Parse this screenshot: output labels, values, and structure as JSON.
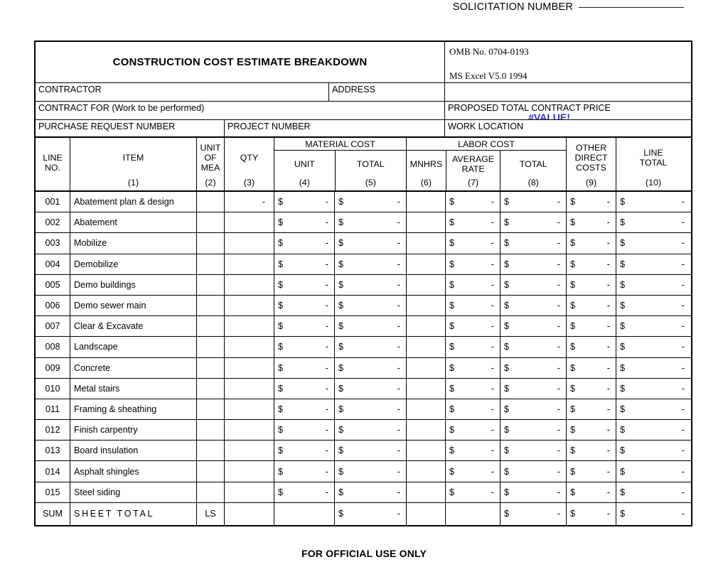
{
  "solicitation": {
    "label": "SOLICITATION NUMBER",
    "blank_line": ""
  },
  "header": {
    "title": "CONSTRUCTION COST ESTIMATE BREAKDOWN",
    "omb_number": "OMB No. 0704-0193",
    "software_version": "MS Excel V5.0 1994",
    "contractor_label": "CONTRACTOR",
    "contractor_value": "",
    "address_label": "ADDRESS",
    "address_value": "",
    "contract_for_label": "CONTRACT FOR (Work to be performed)",
    "contract_for_value": "",
    "proposed_total_label": "PROPOSED TOTAL CONTRACT PRICE",
    "proposed_total_value": "#VALUE!",
    "proposed_total_color": "#3333cc",
    "purchase_request_label": "PURCHASE REQUEST NUMBER",
    "purchase_request_value": "",
    "project_number_label": "PROJECT NUMBER",
    "project_number_value": "",
    "work_location_label": "WORK LOCATION",
    "work_location_value": ""
  },
  "columns": {
    "line_no": {
      "l1": "LINE",
      "l2": "NO.",
      "num": ""
    },
    "item": {
      "l1": "ITEM",
      "l2": "",
      "num": "(1)"
    },
    "unit_of_mea": {
      "l1": "UNIT",
      "l2": "OF",
      "l3": "MEA",
      "num": "(2)"
    },
    "qty": {
      "l1": "QTY",
      "l2": "",
      "num": "(3)"
    },
    "material_group": "MATERIAL COST",
    "material_unit": {
      "l1": "UNIT",
      "l2": "",
      "num": "(4)"
    },
    "material_total": {
      "l1": "TOTAL",
      "l2": "",
      "num": "(5)"
    },
    "labor_group": "LABOR COST",
    "mnhrs": {
      "l1": "MNHRS",
      "l2": "",
      "num": "(6)"
    },
    "average_rate": {
      "l1": "AVERAGE",
      "l2": "RATE",
      "num": "(7)"
    },
    "labor_total": {
      "l1": "TOTAL",
      "l2": "",
      "num": "(8)"
    },
    "other_direct": {
      "l1": "OTHER",
      "l2": "DIRECT",
      "l3": "COSTS",
      "num": "(9)"
    },
    "line_total": {
      "l1": "LINE",
      "l2": "TOTAL",
      "num": "(10)"
    }
  },
  "currency_symbol": "$",
  "dash": "-",
  "rows": [
    {
      "line_no": "001",
      "item": "Abatement plan & design",
      "uom": "",
      "qty": "-",
      "material_unit": "$|-",
      "material_total": "$|-",
      "mnhrs": "",
      "average_rate": "$|-",
      "labor_total": "$|-",
      "other_direct": "$|-",
      "line_total": "$|-"
    },
    {
      "line_no": "002",
      "item": "Abatement",
      "uom": "",
      "qty": "",
      "material_unit": "$|-",
      "material_total": "$|-",
      "mnhrs": "",
      "average_rate": "$|-",
      "labor_total": "$|-",
      "other_direct": "$|-",
      "line_total": "$|-"
    },
    {
      "line_no": "003",
      "item": "Mobilize",
      "uom": "",
      "qty": "",
      "material_unit": "$|-",
      "material_total": "$|-",
      "mnhrs": "",
      "average_rate": "$|-",
      "labor_total": "$|-",
      "other_direct": "$|-",
      "line_total": "$|-"
    },
    {
      "line_no": "004",
      "item": "Demobilize",
      "uom": "",
      "qty": "",
      "material_unit": "$|-",
      "material_total": "$|-",
      "mnhrs": "",
      "average_rate": "$|-",
      "labor_total": "$|-",
      "other_direct": "$|-",
      "line_total": "$|-"
    },
    {
      "line_no": "005",
      "item": "Demo buildings",
      "uom": "",
      "qty": "",
      "material_unit": "$|-",
      "material_total": "$|-",
      "mnhrs": "",
      "average_rate": "$|-",
      "labor_total": "$|-",
      "other_direct": "$|-",
      "line_total": "$|-"
    },
    {
      "line_no": "006",
      "item": "Demo sewer main",
      "uom": "",
      "qty": "",
      "material_unit": "$|-",
      "material_total": "$|-",
      "mnhrs": "",
      "average_rate": "$|-",
      "labor_total": "$|-",
      "other_direct": "$|-",
      "line_total": "$|-"
    },
    {
      "line_no": "007",
      "item": "Clear & Excavate",
      "uom": "",
      "qty": "",
      "material_unit": "$|-",
      "material_total": "$|-",
      "mnhrs": "",
      "average_rate": "$|-",
      "labor_total": "$|-",
      "other_direct": "$|-",
      "line_total": "$|-"
    },
    {
      "line_no": "008",
      "item": "Landscape",
      "uom": "",
      "qty": "",
      "material_unit": "$|-",
      "material_total": "$|-",
      "mnhrs": "",
      "average_rate": "$|-",
      "labor_total": "$|-",
      "other_direct": "$|-",
      "line_total": "$|-"
    },
    {
      "line_no": "009",
      "item": "Concrete",
      "uom": "",
      "qty": "",
      "material_unit": "$|-",
      "material_total": "$|-",
      "mnhrs": "",
      "average_rate": "$|-",
      "labor_total": "$|-",
      "other_direct": "$|-",
      "line_total": "$|-"
    },
    {
      "line_no": "010",
      "item": "Metal stairs",
      "uom": "",
      "qty": "",
      "material_unit": "$|-",
      "material_total": "$|-",
      "mnhrs": "",
      "average_rate": "$|-",
      "labor_total": "$|-",
      "other_direct": "$|-",
      "line_total": "$|-"
    },
    {
      "line_no": "011",
      "item": "Framing & sheathing",
      "uom": "",
      "qty": "",
      "material_unit": "$|-",
      "material_total": "$|-",
      "mnhrs": "",
      "average_rate": "$|-",
      "labor_total": "$|-",
      "other_direct": "$|-",
      "line_total": "$|-"
    },
    {
      "line_no": "012",
      "item": "Finish carpentry",
      "uom": "",
      "qty": "",
      "material_unit": "$|-",
      "material_total": "$|-",
      "mnhrs": "",
      "average_rate": "$|-",
      "labor_total": "$|-",
      "other_direct": "$|-",
      "line_total": "$|-"
    },
    {
      "line_no": "013",
      "item": "Board insulation",
      "uom": "",
      "qty": "",
      "material_unit": "$|-",
      "material_total": "$|-",
      "mnhrs": "",
      "average_rate": "$|-",
      "labor_total": "$|-",
      "other_direct": "$|-",
      "line_total": "$|-"
    },
    {
      "line_no": "014",
      "item": "Asphalt shingles",
      "uom": "",
      "qty": "",
      "material_unit": "$|-",
      "material_total": "$|-",
      "mnhrs": "",
      "average_rate": "$|-",
      "labor_total": "$|-",
      "other_direct": "$|-",
      "line_total": "$|-"
    },
    {
      "line_no": "015",
      "item": "Steel siding",
      "uom": "",
      "qty": "",
      "material_unit": "$|-",
      "material_total": "$|-",
      "mnhrs": "",
      "average_rate": "$|-",
      "labor_total": "$|-",
      "other_direct": "$|-",
      "line_total": "$|-"
    }
  ],
  "sum_row": {
    "line_no": "SUM",
    "item": "SHEET TOTAL",
    "uom": "LS",
    "qty": "",
    "material_unit": "",
    "material_total": "$|-",
    "mnhrs": "",
    "average_rate": "",
    "labor_total": "$|-",
    "other_direct": "$|-",
    "line_total": "$|-"
  },
  "footer": {
    "text": "FOR OFFICIAL USE ONLY"
  }
}
